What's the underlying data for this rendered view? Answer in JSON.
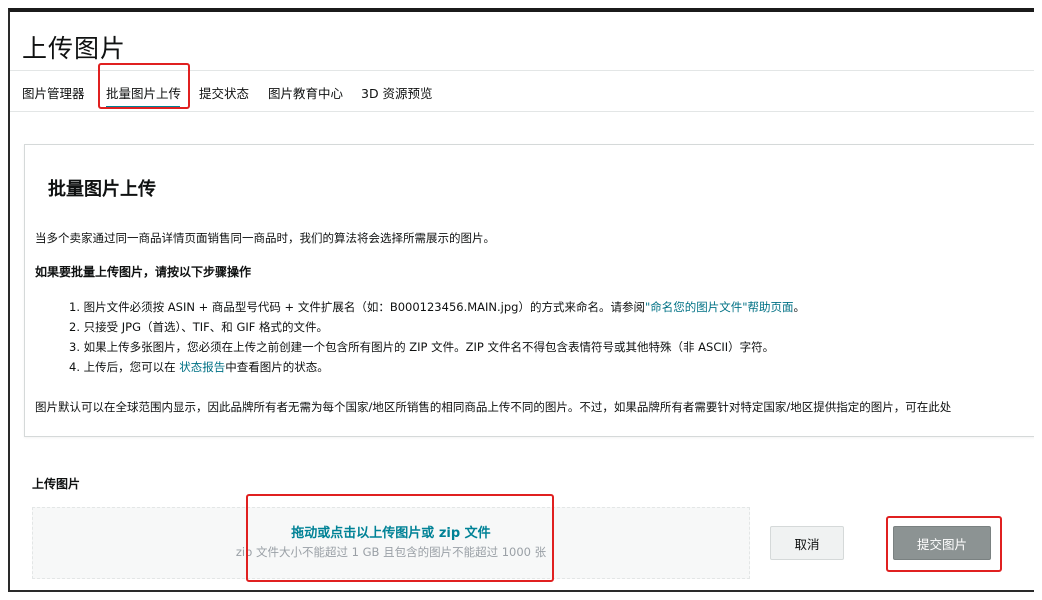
{
  "page": {
    "title": "上传图片"
  },
  "tabs": [
    {
      "label": "图片管理器"
    },
    {
      "label": "批量图片上传",
      "active": true
    },
    {
      "label": "提交状态"
    },
    {
      "label": "图片教育中心"
    },
    {
      "label": "3D 资源预览"
    }
  ],
  "info": {
    "title": "批量图片上传",
    "intro": "当多个卖家通过同一商品详情页面销售同一商品时，我们的算法将会选择所需展示的图片。",
    "steps_heading": "如果要批量上传图片，请按以下步骤操作",
    "step1_text": "1. 图片文件必须按 ASIN + 商品型号代码 + 文件扩展名（如：B000123456.MAIN.jpg）的方式来命名。请参阅",
    "step1_link": "\"命名您的图片文件\"帮助页面",
    "step1_end": "。",
    "step2": "2. 只接受 JPG（首选）、TIF、和 GIF 格式的文件。",
    "step3": "3. 如果上传多张图片，您必须在上传之前创建一个包含所有图片的 ZIP 文件。ZIP 文件名不得包含表情符号或其他特殊（非 ASCII）字符。",
    "step4_text": "4. 上传后，您可以在 ",
    "step4_link": "状态报告",
    "step4_end": "中查看图片的状态。",
    "note": "图片默认可以在全球范围内显示，因此品牌所有者无需为每个国家/地区所销售的相同商品上传不同的图片。不过，如果品牌所有者需要针对特定国家/地区提供指定的图片，可在此处"
  },
  "upload": {
    "label": "上传图片",
    "drop_main": "拖动或点击以上传图片或 zip 文件",
    "drop_sub": "zip 文件大小不能超过 1 GB 且包含的图片不能超过 1000 张",
    "cancel_label": "取消",
    "submit_label": "提交图片"
  },
  "colors": {
    "accent_teal": "#008296",
    "link": "#007185",
    "highlight_red": "#e02020",
    "submit_bg": "#8c9393"
  }
}
